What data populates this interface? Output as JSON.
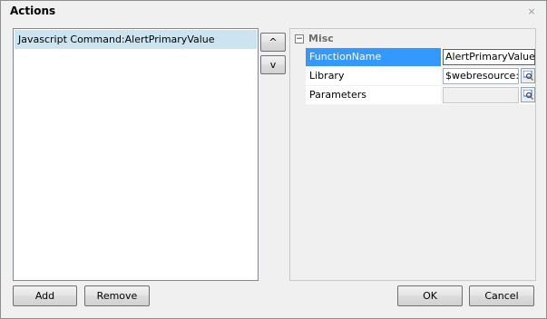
{
  "dialog": {
    "title": "Actions",
    "close_glyph": "×"
  },
  "actions_list": {
    "items": [
      {
        "label": "Javascript Command:AlertPrimaryValue",
        "selected": true
      }
    ]
  },
  "order_buttons": {
    "up_label": "^",
    "down_label": "v"
  },
  "properties": {
    "category_toggle": "−",
    "category_label": "Misc",
    "rows": [
      {
        "name": "FunctionName",
        "value": "AlertPrimaryValue",
        "selected": true
      },
      {
        "name": "Library",
        "value": "$webresource:co",
        "selected": false
      },
      {
        "name": "Parameters",
        "value": "",
        "selected": false
      }
    ]
  },
  "bottom_buttons": {
    "add_label": "Add",
    "remove_label": "Remove",
    "ok_label": "OK",
    "cancel_label": "Cancel"
  },
  "colors": {
    "selection_blue": "#3399ff",
    "list_highlight": "#cce4ef",
    "dialog_bg": "#f0f0f0"
  },
  "icons": {
    "close": "close-icon",
    "lookup": "lookup-icon",
    "collapse": "collapse-icon"
  }
}
